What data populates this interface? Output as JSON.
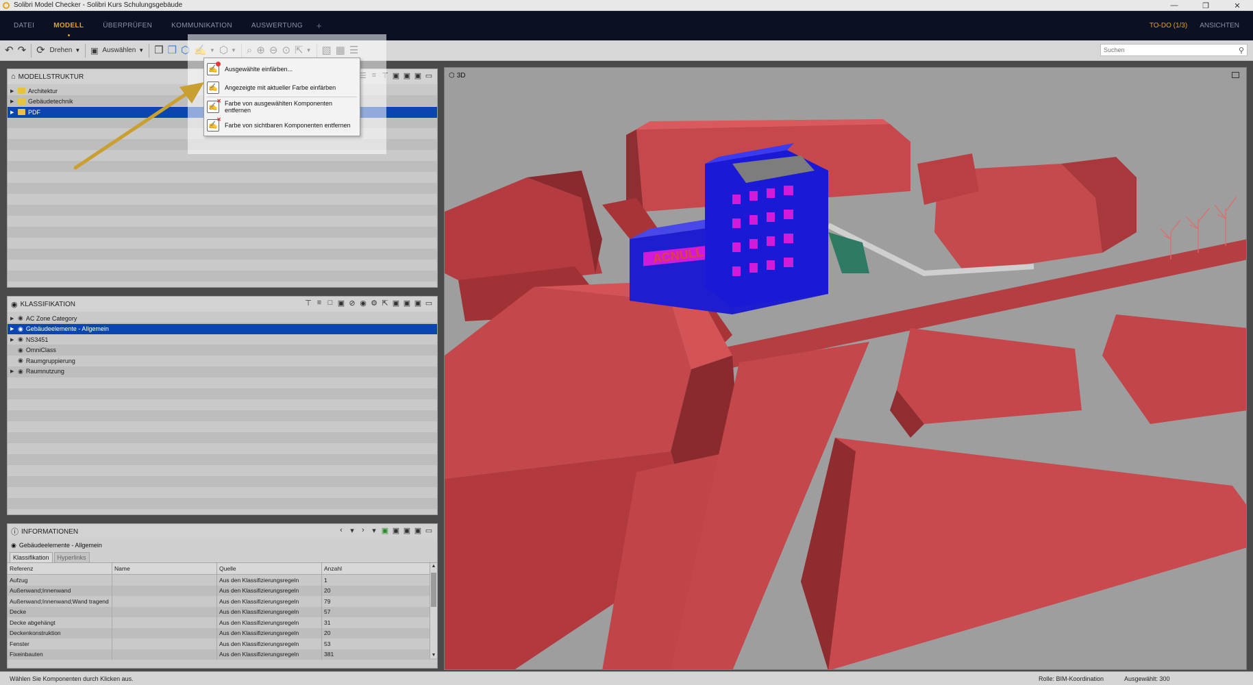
{
  "window": {
    "title": "Solibri Model Checker - Solibri Kurs Schulungsgebäude",
    "controls": [
      "minimize-icon",
      "restore-icon",
      "close-icon"
    ]
  },
  "menu": {
    "items": [
      "DATEI",
      "MODELL",
      "ÜBERPRÜFEN",
      "KOMMUNIKATION",
      "AUSWERTUNG"
    ],
    "active": "MODELL",
    "add": "+",
    "todo": "TO-DO (1/3)",
    "ansichten": "ANSICHTEN"
  },
  "toolbar": {
    "rotate_label": "Drehen",
    "select_label": "Auswählen",
    "search_placeholder": "Suchen"
  },
  "model_structure": {
    "title": "MODELLSTRUKTUR",
    "items": [
      {
        "label": "Architektur",
        "selected": false
      },
      {
        "label": "Gebäudetechnik",
        "selected": false
      },
      {
        "label": "PDF",
        "selected": true
      }
    ]
  },
  "classification": {
    "title": "KLASSIFIKATION",
    "items": [
      {
        "label": "AC Zone Category",
        "selected": false,
        "expandable": true
      },
      {
        "label": "Gebäudeelemente - Allgemein",
        "selected": true,
        "expandable": true
      },
      {
        "label": "NS3451",
        "selected": false,
        "expandable": true
      },
      {
        "label": "OmniClass",
        "selected": false,
        "expandable": false
      },
      {
        "label": "Raumgruppierung",
        "selected": false,
        "expandable": false
      },
      {
        "label": "Raumnutzung",
        "selected": false,
        "expandable": true
      }
    ]
  },
  "information": {
    "title": "INFORMATIONEN",
    "subject": "Gebäudeelemente - Allgemein",
    "tabs": [
      "Klassifikation",
      "Hyperlinks"
    ],
    "active_tab": "Klassifikation",
    "columns": [
      "Referenz",
      "Name",
      "Quelle",
      "Anzahl"
    ],
    "rows": [
      [
        "Aufzug",
        "",
        "Aus den Klassifizierungsregeln",
        "1"
      ],
      [
        "Außenwand;Innenwand",
        "",
        "Aus den Klassifizierungsregeln",
        "20"
      ],
      [
        "Außenwand;Innenwand;Wand tragend",
        "",
        "Aus den Klassifizierungsregeln",
        "79"
      ],
      [
        "Decke",
        "",
        "Aus den Klassifizierungsregeln",
        "57"
      ],
      [
        "Decke abgehängt",
        "",
        "Aus den Klassifizierungsregeln",
        "31"
      ],
      [
        "Deckenkonstruktion",
        "",
        "Aus den Klassifizierungsregeln",
        "20"
      ],
      [
        "Fenster",
        "",
        "Aus den Klassifizierungsregeln",
        "53"
      ],
      [
        "Fixeinbauten",
        "",
        "Aus den Klassifizierungsregeln",
        "381"
      ]
    ]
  },
  "viewport": {
    "label": "3D",
    "sign_text": "ACNULL"
  },
  "color_menu": {
    "items": [
      "Ausgewählte einfärben...",
      "Angezeigte mit aktueller Farbe einfärben",
      "Farbe von ausgewählten Komponenten entfernen",
      "Farbe von sichtbaren Komponenten entfernen"
    ]
  },
  "status": {
    "message": "Wählen Sie Komponenten durch Klicken aus.",
    "rolle": "Rolle: BIM-Koordination",
    "ausgewaehlt": "Ausgewählt: 300"
  },
  "colors": {
    "menubar_bg": "#0b1022",
    "accent": "#e7a21b",
    "selection": "#0b46b0",
    "building_red": "#c94a4e",
    "building_blue": "#1717d8",
    "window_magenta": "#d11bd8",
    "arrow": "#c9a030"
  }
}
